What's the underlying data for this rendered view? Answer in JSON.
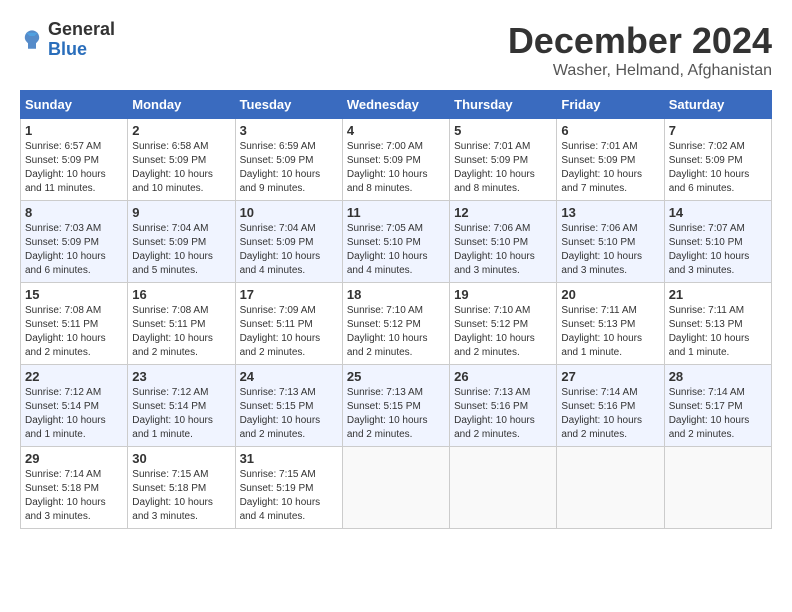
{
  "header": {
    "logo_general": "General",
    "logo_blue": "Blue",
    "month_title": "December 2024",
    "location": "Washer, Helmand, Afghanistan"
  },
  "weekdays": [
    "Sunday",
    "Monday",
    "Tuesday",
    "Wednesday",
    "Thursday",
    "Friday",
    "Saturday"
  ],
  "weeks": [
    [
      {
        "day": "1",
        "sunrise": "Sunrise: 6:57 AM",
        "sunset": "Sunset: 5:09 PM",
        "daylight": "Daylight: 10 hours and 11 minutes."
      },
      {
        "day": "2",
        "sunrise": "Sunrise: 6:58 AM",
        "sunset": "Sunset: 5:09 PM",
        "daylight": "Daylight: 10 hours and 10 minutes."
      },
      {
        "day": "3",
        "sunrise": "Sunrise: 6:59 AM",
        "sunset": "Sunset: 5:09 PM",
        "daylight": "Daylight: 10 hours and 9 minutes."
      },
      {
        "day": "4",
        "sunrise": "Sunrise: 7:00 AM",
        "sunset": "Sunset: 5:09 PM",
        "daylight": "Daylight: 10 hours and 8 minutes."
      },
      {
        "day": "5",
        "sunrise": "Sunrise: 7:01 AM",
        "sunset": "Sunset: 5:09 PM",
        "daylight": "Daylight: 10 hours and 8 minutes."
      },
      {
        "day": "6",
        "sunrise": "Sunrise: 7:01 AM",
        "sunset": "Sunset: 5:09 PM",
        "daylight": "Daylight: 10 hours and 7 minutes."
      },
      {
        "day": "7",
        "sunrise": "Sunrise: 7:02 AM",
        "sunset": "Sunset: 5:09 PM",
        "daylight": "Daylight: 10 hours and 6 minutes."
      }
    ],
    [
      {
        "day": "8",
        "sunrise": "Sunrise: 7:03 AM",
        "sunset": "Sunset: 5:09 PM",
        "daylight": "Daylight: 10 hours and 6 minutes."
      },
      {
        "day": "9",
        "sunrise": "Sunrise: 7:04 AM",
        "sunset": "Sunset: 5:09 PM",
        "daylight": "Daylight: 10 hours and 5 minutes."
      },
      {
        "day": "10",
        "sunrise": "Sunrise: 7:04 AM",
        "sunset": "Sunset: 5:09 PM",
        "daylight": "Daylight: 10 hours and 4 minutes."
      },
      {
        "day": "11",
        "sunrise": "Sunrise: 7:05 AM",
        "sunset": "Sunset: 5:10 PM",
        "daylight": "Daylight: 10 hours and 4 minutes."
      },
      {
        "day": "12",
        "sunrise": "Sunrise: 7:06 AM",
        "sunset": "Sunset: 5:10 PM",
        "daylight": "Daylight: 10 hours and 3 minutes."
      },
      {
        "day": "13",
        "sunrise": "Sunrise: 7:06 AM",
        "sunset": "Sunset: 5:10 PM",
        "daylight": "Daylight: 10 hours and 3 minutes."
      },
      {
        "day": "14",
        "sunrise": "Sunrise: 7:07 AM",
        "sunset": "Sunset: 5:10 PM",
        "daylight": "Daylight: 10 hours and 3 minutes."
      }
    ],
    [
      {
        "day": "15",
        "sunrise": "Sunrise: 7:08 AM",
        "sunset": "Sunset: 5:11 PM",
        "daylight": "Daylight: 10 hours and 2 minutes."
      },
      {
        "day": "16",
        "sunrise": "Sunrise: 7:08 AM",
        "sunset": "Sunset: 5:11 PM",
        "daylight": "Daylight: 10 hours and 2 minutes."
      },
      {
        "day": "17",
        "sunrise": "Sunrise: 7:09 AM",
        "sunset": "Sunset: 5:11 PM",
        "daylight": "Daylight: 10 hours and 2 minutes."
      },
      {
        "day": "18",
        "sunrise": "Sunrise: 7:10 AM",
        "sunset": "Sunset: 5:12 PM",
        "daylight": "Daylight: 10 hours and 2 minutes."
      },
      {
        "day": "19",
        "sunrise": "Sunrise: 7:10 AM",
        "sunset": "Sunset: 5:12 PM",
        "daylight": "Daylight: 10 hours and 2 minutes."
      },
      {
        "day": "20",
        "sunrise": "Sunrise: 7:11 AM",
        "sunset": "Sunset: 5:13 PM",
        "daylight": "Daylight: 10 hours and 1 minute."
      },
      {
        "day": "21",
        "sunrise": "Sunrise: 7:11 AM",
        "sunset": "Sunset: 5:13 PM",
        "daylight": "Daylight: 10 hours and 1 minute."
      }
    ],
    [
      {
        "day": "22",
        "sunrise": "Sunrise: 7:12 AM",
        "sunset": "Sunset: 5:14 PM",
        "daylight": "Daylight: 10 hours and 1 minute."
      },
      {
        "day": "23",
        "sunrise": "Sunrise: 7:12 AM",
        "sunset": "Sunset: 5:14 PM",
        "daylight": "Daylight: 10 hours and 1 minute."
      },
      {
        "day": "24",
        "sunrise": "Sunrise: 7:13 AM",
        "sunset": "Sunset: 5:15 PM",
        "daylight": "Daylight: 10 hours and 2 minutes."
      },
      {
        "day": "25",
        "sunrise": "Sunrise: 7:13 AM",
        "sunset": "Sunset: 5:15 PM",
        "daylight": "Daylight: 10 hours and 2 minutes."
      },
      {
        "day": "26",
        "sunrise": "Sunrise: 7:13 AM",
        "sunset": "Sunset: 5:16 PM",
        "daylight": "Daylight: 10 hours and 2 minutes."
      },
      {
        "day": "27",
        "sunrise": "Sunrise: 7:14 AM",
        "sunset": "Sunset: 5:16 PM",
        "daylight": "Daylight: 10 hours and 2 minutes."
      },
      {
        "day": "28",
        "sunrise": "Sunrise: 7:14 AM",
        "sunset": "Sunset: 5:17 PM",
        "daylight": "Daylight: 10 hours and 2 minutes."
      }
    ],
    [
      {
        "day": "29",
        "sunrise": "Sunrise: 7:14 AM",
        "sunset": "Sunset: 5:18 PM",
        "daylight": "Daylight: 10 hours and 3 minutes."
      },
      {
        "day": "30",
        "sunrise": "Sunrise: 7:15 AM",
        "sunset": "Sunset: 5:18 PM",
        "daylight": "Daylight: 10 hours and 3 minutes."
      },
      {
        "day": "31",
        "sunrise": "Sunrise: 7:15 AM",
        "sunset": "Sunset: 5:19 PM",
        "daylight": "Daylight: 10 hours and 4 minutes."
      },
      null,
      null,
      null,
      null
    ]
  ]
}
